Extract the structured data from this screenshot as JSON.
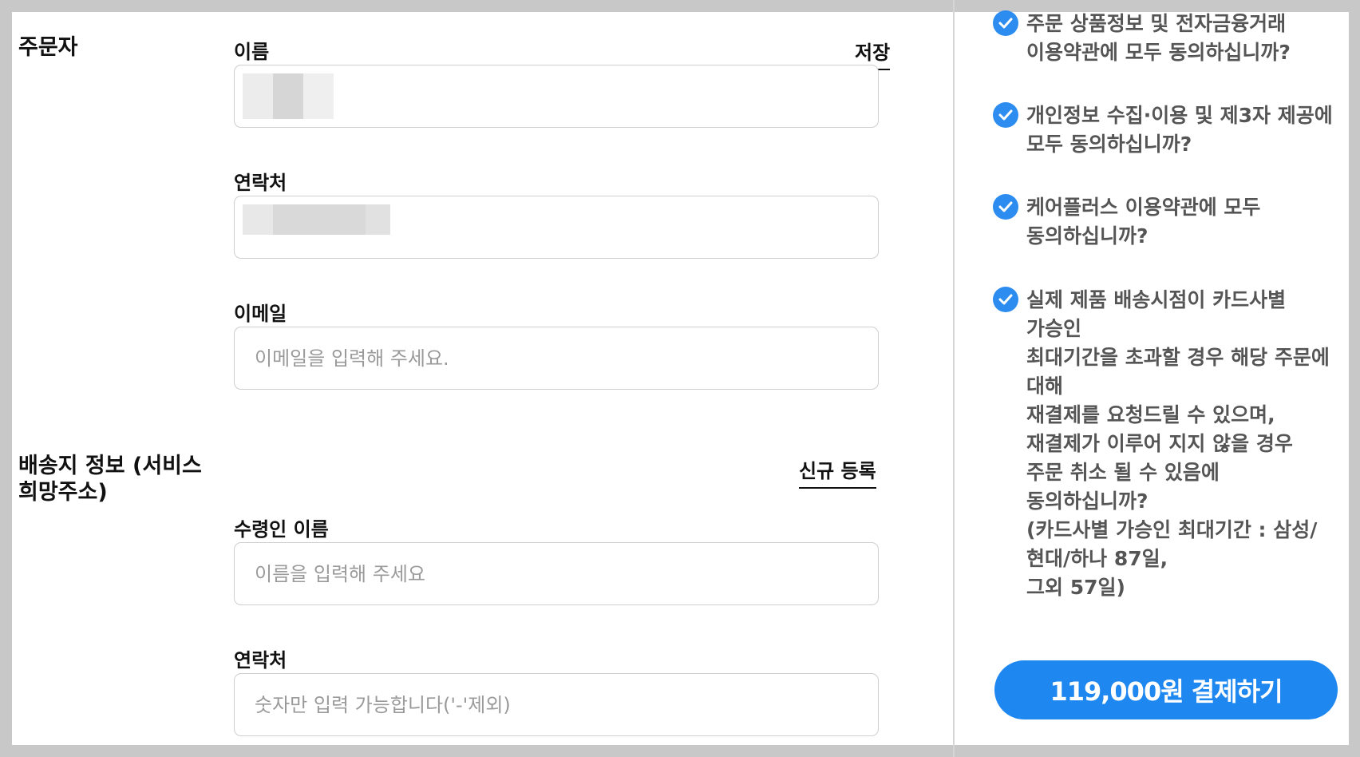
{
  "orderer": {
    "section_title": "주문자",
    "save_label": "저장",
    "name_label": "이름",
    "phone_label": "연락처",
    "email_label": "이메일",
    "email_placeholder": "이메일을 입력해 주세요."
  },
  "shipping": {
    "section_title": "배송지 정보 (서비스\n희망주소)",
    "new_label": "신규 등록",
    "recipient_label": "수령인 이름",
    "recipient_placeholder": "이름을 입력해 주세요",
    "phone_label": "연락처",
    "phone_placeholder": "숫자만 입력 가능합니다('-'제외)"
  },
  "agreements": [
    {
      "text": "주문 상품정보 및 전자금융거래\n이용약관에 모두 동의하십니까?",
      "checked": true
    },
    {
      "text": "개인정보 수집·이용 및 제3자 제공에\n모두 동의하십니까?",
      "checked": true
    },
    {
      "text": "케어플러스 이용약관에 모두\n동의하십니까?",
      "checked": true
    },
    {
      "text": "실제 제품 배송시점이 카드사별\n가승인\n최대기간을 초과할 경우 해당 주문에\n대해\n재결제를 요청드릴 수 있으며,\n재결제가 이루어 지지 않을 경우\n주문 취소 될 수 있음에\n동의하십니까?\n(카드사별 가승인 최대기간 : 삼성/\n현대/하나 87일,\n그외 57일)",
      "checked": true
    }
  ],
  "pay_button_label": "119,000원 결제하기",
  "colors": {
    "accent": "#1e88f0",
    "check": "#2d8cf0"
  }
}
